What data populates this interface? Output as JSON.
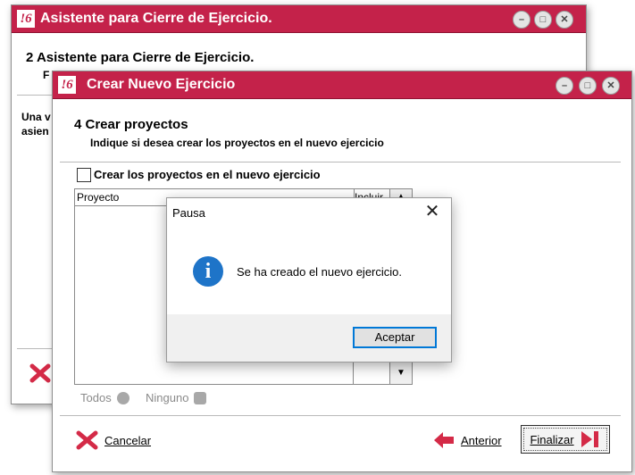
{
  "back_window": {
    "title": "Asistente para Cierre de Ejercicio.",
    "step_number": "2",
    "heading": "Asistente para Cierre de Ejercicio.",
    "subheading_partial": "F",
    "body_partial_1": "Una v",
    "body_partial_2": "asien"
  },
  "front_window": {
    "title": "Crear Nuevo Ejercicio",
    "step_number": "4",
    "heading": "Crear proyectos",
    "subheading": "Indique si desea crear los proyectos en el nuevo ejercicio",
    "checkbox_label": "Crear los proyectos en el nuevo ejercicio",
    "grid": {
      "col_proyecto": "Proyecto",
      "col_incluir": "Incluir"
    },
    "todos_label": "Todos",
    "ninguno_label": "Ninguno",
    "cancel_label": "Cancelar",
    "back_label": "Anterior",
    "finish_label": "Finalizar"
  },
  "dialog": {
    "title": "Pausa",
    "message": "Se ha creado el nuevo ejercicio.",
    "ok_label": "Aceptar"
  },
  "colors": {
    "titlebar": "#c4224a",
    "accent_red": "#d42a47",
    "info_blue": "#1e74c8"
  }
}
